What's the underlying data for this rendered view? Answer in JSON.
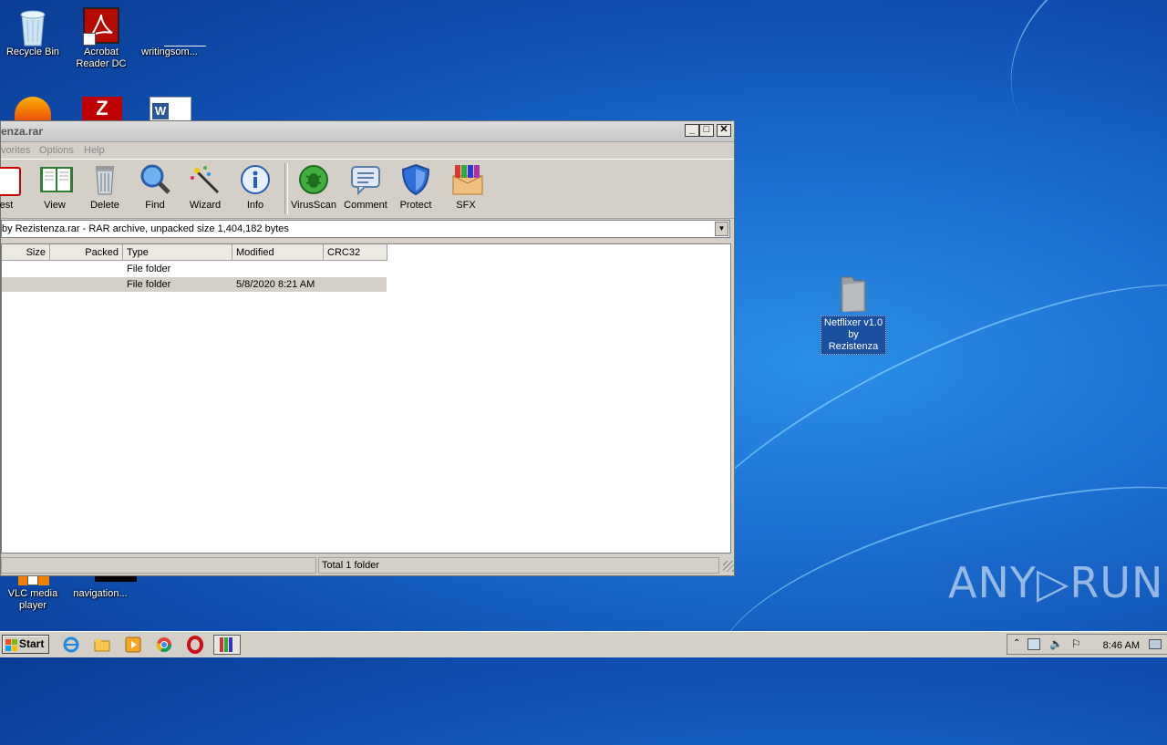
{
  "desktop": {
    "icons": [
      {
        "label": "Recycle Bin"
      },
      {
        "label": "Acrobat Reader DC"
      },
      {
        "label": "writingsom..."
      },
      {
        "label": "VLC media player"
      },
      {
        "label": "navigation..."
      }
    ],
    "folder": {
      "line1": "Netflixer v1.0",
      "line2": "by Rezistenza"
    }
  },
  "window": {
    "title": "enza.rar",
    "buttons": {
      "minimize": "_",
      "maximize": "□",
      "close": "✕"
    },
    "menu": [
      "vorites",
      "Options",
      "Help"
    ],
    "toolbar": [
      {
        "label": "est"
      },
      {
        "label": "View"
      },
      {
        "label": "Delete"
      },
      {
        "label": "Find"
      },
      {
        "label": "Wizard"
      },
      {
        "label": "Info"
      },
      {
        "label": "VirusScan"
      },
      {
        "label": "Comment"
      },
      {
        "label": "Protect"
      },
      {
        "label": "SFX"
      }
    ],
    "address": "by Rezistenza.rar - RAR archive, unpacked size 1,404,182 bytes",
    "columns": [
      "Size",
      "Packed",
      "Type",
      "Modified",
      "CRC32"
    ],
    "rows": [
      {
        "size": "",
        "packed": "",
        "type": "File folder",
        "modified": "",
        "crc": ""
      },
      {
        "size": "",
        "packed": "",
        "type": "File folder",
        "modified": "5/8/2020 8:21 AM",
        "crc": ""
      }
    ],
    "status": {
      "left": "",
      "right": "Total 1 folder"
    }
  },
  "watermark": "ANY▷RUN",
  "taskbar": {
    "start_label": "Start",
    "clock": "8:46 AM"
  },
  "colors": {
    "desktop": "#1c6fd0",
    "selection": "#1b4fa0",
    "chrome": "#d4d0c8"
  }
}
